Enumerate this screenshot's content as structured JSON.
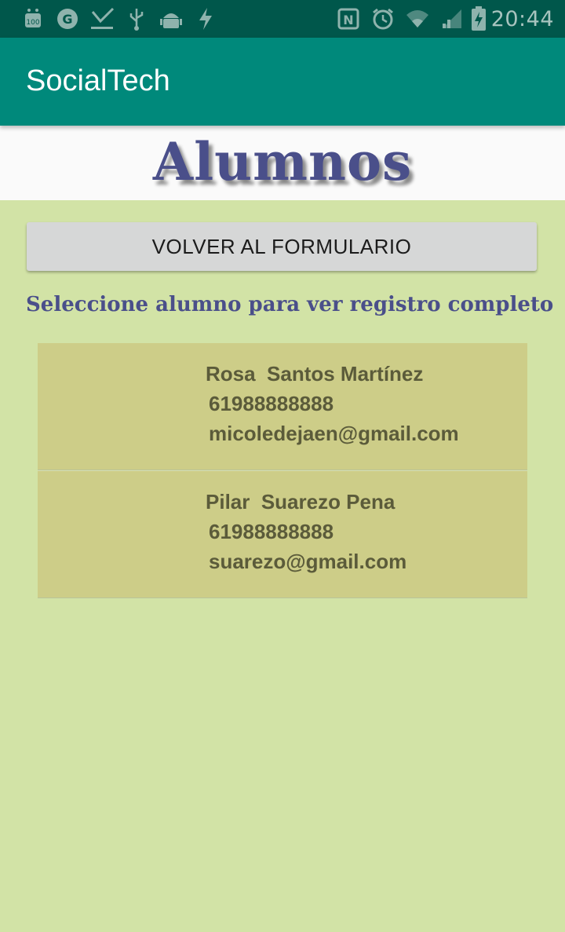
{
  "status_bar": {
    "time": "20:44",
    "left_icons": [
      "android-100-icon",
      "g-notification-icon",
      "download-icon",
      "usb-icon",
      "android-debug-icon",
      "flash-icon"
    ],
    "right_icons": [
      "nfc-icon",
      "alarm-icon",
      "wifi-icon",
      "signal-icon",
      "battery-charging-icon"
    ]
  },
  "app_bar": {
    "title": "SocialTech"
  },
  "header": {
    "title": "Alumnos"
  },
  "back_button": {
    "label": "VOLVER AL FORMULARIO"
  },
  "instruction": "Seleccione alumno para ver registro completo",
  "students": [
    {
      "name": "Rosa  Santos Martínez",
      "phone": "61988888888",
      "email": "micoledejaen@gmail.com"
    },
    {
      "name": "Pilar  Suarezo Pena",
      "phone": "61988888888",
      "email": "suarezo@gmail.com"
    }
  ],
  "colors": {
    "status_bar": "#00574b",
    "app_bar": "#00897b",
    "background": "#d2e3a6",
    "list_item": "#cdcd88",
    "header_text": "#4a4f8a"
  }
}
